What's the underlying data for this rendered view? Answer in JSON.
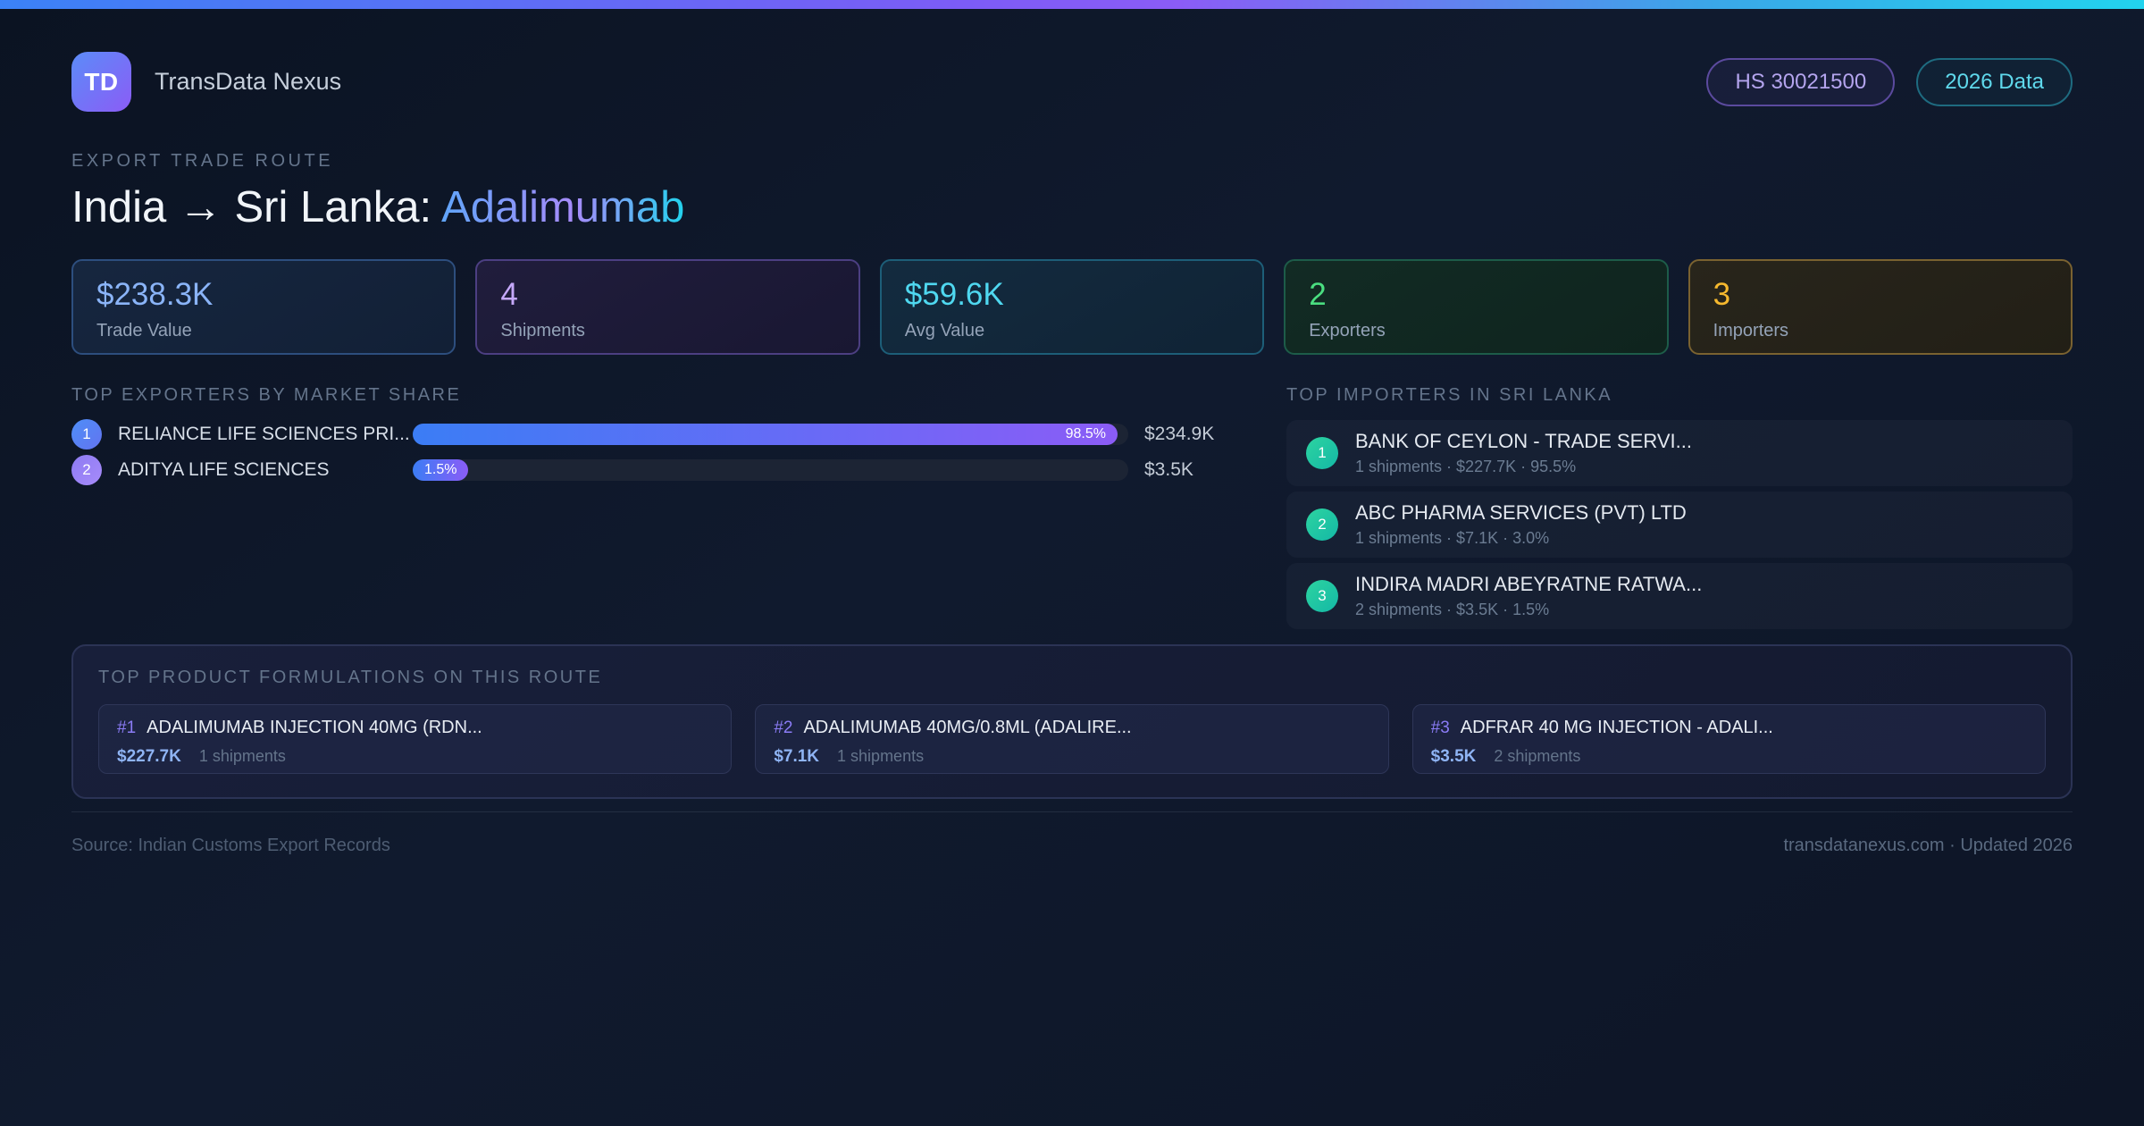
{
  "colors": {
    "accent_blue": "#3b82f6",
    "accent_purple": "#8b5cf6",
    "accent_cyan": "#22d3ee",
    "accent_green": "#4ade80",
    "accent_amber": "#f5b82e",
    "teal_rank": "#14b8a6"
  },
  "header": {
    "logo_text": "TD",
    "app_name": "TransData Nexus",
    "badges": [
      {
        "label": "HS 30021500"
      },
      {
        "label": "2026 Data"
      }
    ]
  },
  "hero": {
    "eyebrow": "EXPORT TRADE ROUTE",
    "title_prefix": "India → Sri Lanka: ",
    "title_highlight": "Adalimumab"
  },
  "stats": [
    {
      "value": "$238.3K",
      "label": "Trade Value"
    },
    {
      "value": "4",
      "label": "Shipments"
    },
    {
      "value": "$59.6K",
      "label": "Avg Value"
    },
    {
      "value": "2",
      "label": "Exporters"
    },
    {
      "value": "3",
      "label": "Importers"
    }
  ],
  "exporters": {
    "heading": "TOP EXPORTERS BY MARKET SHARE",
    "rows": [
      {
        "rank": "1",
        "name": "RELIANCE LIFE SCIENCES PRI...",
        "share_pct": 98.5,
        "share_label": "98.5%",
        "value": "$234.9K"
      },
      {
        "rank": "2",
        "name": "ADITYA LIFE SCIENCES",
        "share_pct": 1.5,
        "share_label": "1.5%",
        "value": "$3.5K"
      }
    ]
  },
  "importers": {
    "heading": "TOP IMPORTERS IN SRI LANKA",
    "items": [
      {
        "rank": "1",
        "name": "BANK OF CEYLON - TRADE SERVI...",
        "meta": "1 shipments · $227.7K · 95.5%"
      },
      {
        "rank": "2",
        "name": "ABC PHARMA SERVICES (PVT) LTD",
        "meta": "1 shipments · $7.1K · 3.0%"
      },
      {
        "rank": "3",
        "name": "INDIRA MADRI ABEYRATNE RATWA...",
        "meta": "2 shipments · $3.5K · 1.5%"
      }
    ]
  },
  "products": {
    "heading": "TOP PRODUCT FORMULATIONS ON THIS ROUTE",
    "cards": [
      {
        "rank": "#1",
        "name": "ADALIMUMAB INJECTION 40MG (RDN...",
        "value": "$227.7K",
        "shipments": "1 shipments"
      },
      {
        "rank": "#2",
        "name": "ADALIMUMAB 40MG/0.8ML (ADALIRE...",
        "value": "$7.1K",
        "shipments": "1 shipments"
      },
      {
        "rank": "#3",
        "name": "ADFRAR 40 MG INJECTION - ADALI...",
        "value": "$3.5K",
        "shipments": "2 shipments"
      }
    ]
  },
  "footer": {
    "source": "Source: Indian Customs Export Records",
    "site": "transdatanexus.com · Updated 2026"
  }
}
